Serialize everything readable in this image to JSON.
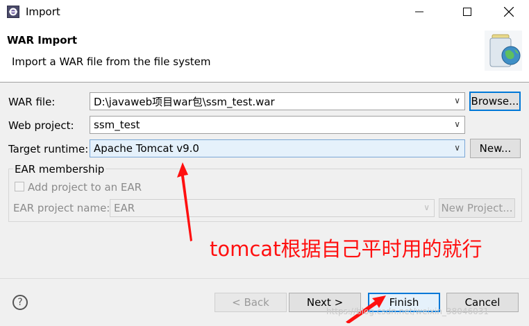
{
  "window": {
    "title": "Import",
    "controls": [
      "minimize",
      "maximize",
      "close"
    ]
  },
  "header": {
    "title": "WAR Import",
    "description": "Import a WAR file from the file system"
  },
  "form": {
    "war_file_label": "WAR file:",
    "war_file_value": "D:\\javaweb项目war包\\ssm_test.war",
    "browse_label": "Browse...",
    "web_project_label": "Web project:",
    "web_project_value": "ssm_test",
    "target_runtime_label": "Target runtime:",
    "target_runtime_value": "Apache Tomcat v9.0",
    "new_label": "New..."
  },
  "ear": {
    "group_label": "EAR membership",
    "add_label": "Add project to an EAR",
    "add_checked": false,
    "project_name_label": "EAR project name:",
    "project_name_value": "EAR",
    "new_project_label": "New Project..."
  },
  "footer": {
    "help_icon": "help-icon",
    "back_label": "< Back",
    "next_label": "Next >",
    "finish_label": "Finish",
    "cancel_label": "Cancel"
  },
  "annotation": {
    "text": "tomcat根据自己平时用的就行",
    "color": "#ff1010"
  },
  "watermark": "https://blog.csdn.net/weixin_38046031"
}
